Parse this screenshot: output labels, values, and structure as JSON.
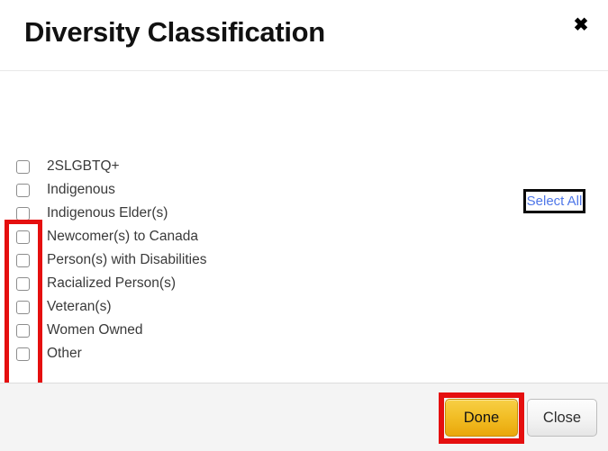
{
  "dialog": {
    "title": "Diversity Classification",
    "close_icon": "close-x-icon",
    "close_label": "✖"
  },
  "body": {
    "select_all_label": "Select All",
    "options": [
      {
        "label": "2SLGBTQ+",
        "checked": false
      },
      {
        "label": "Indigenous",
        "checked": false
      },
      {
        "label": "Indigenous Elder(s)",
        "checked": false
      },
      {
        "label": "Newcomer(s) to Canada",
        "checked": false
      },
      {
        "label": "Person(s) with Disabilities",
        "checked": false
      },
      {
        "label": "Racialized Person(s)",
        "checked": false
      },
      {
        "label": "Veteran(s)",
        "checked": false
      },
      {
        "label": "Women Owned",
        "checked": false
      },
      {
        "label": "Other",
        "checked": false
      }
    ]
  },
  "footer": {
    "done_label": "Done",
    "close_label": "Close"
  },
  "annotations": {
    "highlight_color": "#e50f0f",
    "select_all_box_color": "#0a0a0a",
    "link_color": "#4f77e8",
    "done_button_color": "#f2be25"
  },
  "cursor": {
    "type": "pointer-hand-cursor"
  }
}
